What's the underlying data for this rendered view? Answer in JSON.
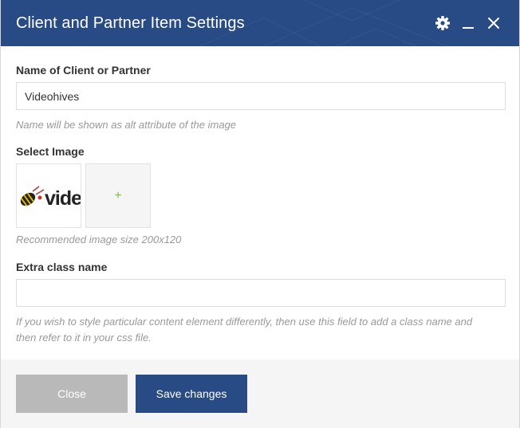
{
  "dialog": {
    "title": "Client and Partner Item Settings",
    "icons": {
      "settings": "gear-icon",
      "minimize": "minimize-icon",
      "close": "close-icon"
    }
  },
  "fields": {
    "name": {
      "label": "Name of Client or Partner",
      "value": "Videohives",
      "hint": "Name will be shown as alt attribute of the image"
    },
    "image": {
      "label": "Select Image",
      "thumbnail_text": "vide",
      "add_icon": "+",
      "hint": "Recommended image size 200x120"
    },
    "extra_class": {
      "label": "Extra class name",
      "value": "",
      "hint": "If you wish to style particular content element differently, then use this field to add a class name and then refer to it in your css file."
    }
  },
  "footer": {
    "close_label": "Close",
    "save_label": "Save changes"
  },
  "colors": {
    "header": "#284b85",
    "save_button": "#284b85",
    "close_button": "#b9b9b9",
    "add_plus": "#7bc043"
  }
}
